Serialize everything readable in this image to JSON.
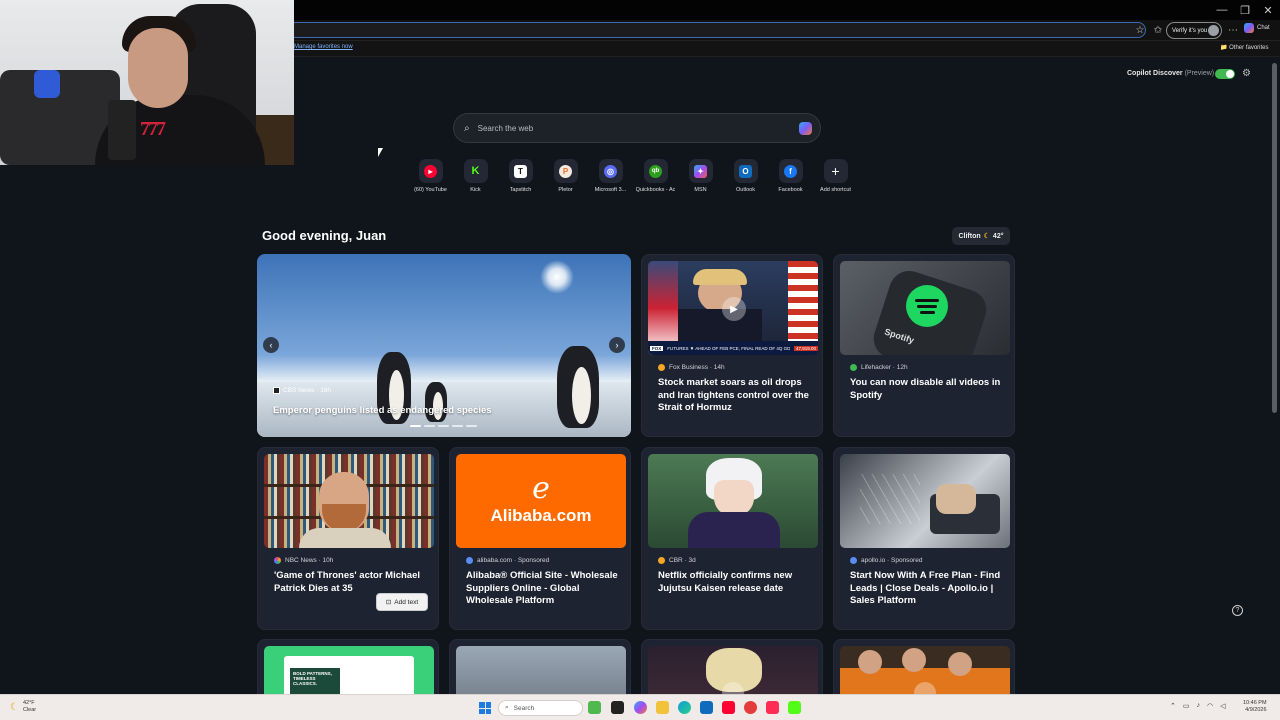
{
  "browser": {
    "verify_label": "Verify it's you",
    "chat_label": "Chat",
    "fav_link": "Manage favorites now",
    "other_favorites": "Other favorites",
    "window_controls": [
      "—",
      "❐",
      "✕"
    ]
  },
  "header": {
    "discover_label": "Copilot Discover",
    "discover_preview": "(Preview)"
  },
  "search": {
    "placeholder": "Search the web"
  },
  "shortcuts": [
    {
      "label": "(60) YouTube",
      "icon": "youtube-icon",
      "color": "#ff0033",
      "glyph": "▶"
    },
    {
      "label": "Kick",
      "icon": "kick-icon",
      "color": "#53fc18",
      "glyph": "K"
    },
    {
      "label": "Tapstitch",
      "icon": "tapstitch-icon",
      "color": "#ffffff",
      "glyph": "T"
    },
    {
      "label": "Pletor",
      "icon": "pletor-icon",
      "color": "#f06a28",
      "glyph": "P"
    },
    {
      "label": "Microsoft 3...",
      "icon": "microsoft-365-icon",
      "color": "#5b6cf0",
      "glyph": "◎"
    },
    {
      "label": "Quickbooks - Ac",
      "icon": "quickbooks-icon",
      "color": "#2ca01c",
      "glyph": "qb"
    },
    {
      "label": "MSN",
      "icon": "msn-icon",
      "color": "#7b61ff",
      "glyph": "✦"
    },
    {
      "label": "Outlook",
      "icon": "outlook-icon",
      "color": "#0f6cbd",
      "glyph": "O"
    },
    {
      "label": "Facebook",
      "icon": "facebook-icon",
      "color": "#1877f2",
      "glyph": "f"
    },
    {
      "label": "Add shortcut",
      "icon": "plus-icon",
      "color": "transparent",
      "glyph": "+"
    }
  ],
  "greeting": "Good evening, Juan",
  "weather": {
    "city": "Clifton",
    "temp": "42°"
  },
  "hero": {
    "source": "CBS News · 16h",
    "title": "Emperor penguins listed as endangered species"
  },
  "cards": [
    {
      "source": "Fox Business · 14h",
      "title": "Stock market soars as oil drops and Iran tightens control over the Strait of Hormuz",
      "src_color": "#f5a623"
    },
    {
      "source": "Lifehacker · 12h",
      "title": "You can now disable all videos in Spotify",
      "src_color": "#3fb950"
    },
    {
      "source": "NBC News · 10h",
      "title": "'Game of Thrones' actor Michael Patrick Dies at 35",
      "src_color": "#e84a5f"
    },
    {
      "source": "alibaba.com · Sponsored",
      "title": "Alibaba® Official Site - Wholesale Suppliers Online - Global Wholesale Platform",
      "src_color": "#5b8cf0"
    },
    {
      "source": "CBR · 3d",
      "title": "Netflix officially confirms new Jujutsu Kaisen release date",
      "src_color": "#f5a623"
    },
    {
      "source": "apollo.io · Sponsored",
      "title": "Start Now With A Free Plan - Find Leads | Close Deals - Apollo.io | Sales Platform",
      "src_color": "#5b8cf0"
    }
  ],
  "fox_ticker": "FUTURES ▼ AHEAD OF FEB PCE, FINAL READ OF 4Q GDP",
  "fox_ticker_value": "47,919.00",
  "spotify_text": "Spotify",
  "alibaba_logo": "Alibaba.com",
  "add_text_label": "Add text",
  "promo_text": "BOLD PATTERNS, TIMELESS CLASSICS.",
  "taskbar": {
    "weather_temp": "42°F",
    "weather_desc": "Clear",
    "search_label": "Search",
    "time": "10:46 PM",
    "date": "4/9/2026"
  }
}
